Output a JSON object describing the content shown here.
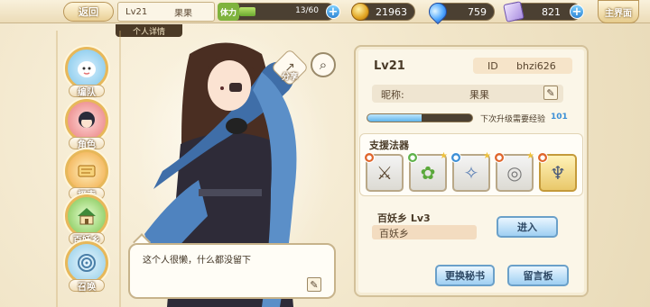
{
  "topbar": {
    "back_label": "返回",
    "level": "Lv21",
    "player_name": "果果",
    "stamina_label": "体力",
    "stamina_value": "13/60",
    "stamina_fraction": 0.22,
    "coins": "21963",
    "gems": "759",
    "tickets": "821",
    "home_label": "主界面",
    "subtitle": "个人详情"
  },
  "nav": [
    {
      "label": "编队",
      "icon": "lantern-icon"
    },
    {
      "label": "角色",
      "icon": "character-icon"
    },
    {
      "label": "探索",
      "icon": "scroll-icon"
    },
    {
      "label": "百妖乡",
      "icon": "house-icon"
    },
    {
      "label": "召唤",
      "icon": "summon-icon"
    }
  ],
  "character": {
    "share_label": "分享",
    "bio": "这个人很懒，什么都没留下"
  },
  "profile": {
    "level": "Lv21",
    "id_label": "ID",
    "id_value": "bhzi626",
    "nickname_label": "昵称:",
    "nickname_value": "果果",
    "exp_text": "下次升级需要经验",
    "exp_value": "101",
    "exp_fraction": 0.52,
    "support_title": "支援法器",
    "support_slots": [
      {
        "icon": "sword-icon"
      },
      {
        "icon": "green-orb-icon"
      },
      {
        "icon": "claw-icon"
      },
      {
        "icon": "ring-icon"
      },
      {
        "icon": "trident-icon"
      }
    ],
    "village_title": "百妖乡  Lv3",
    "village_name": "百妖乡",
    "enter_label": "进入",
    "change_secretary_label": "更换秘书",
    "message_board_label": "留言板"
  },
  "colors": {
    "accent_blue": "#5fb4ea",
    "stamina_green": "#7fb33d",
    "frame_gold": "#e7b85a"
  }
}
